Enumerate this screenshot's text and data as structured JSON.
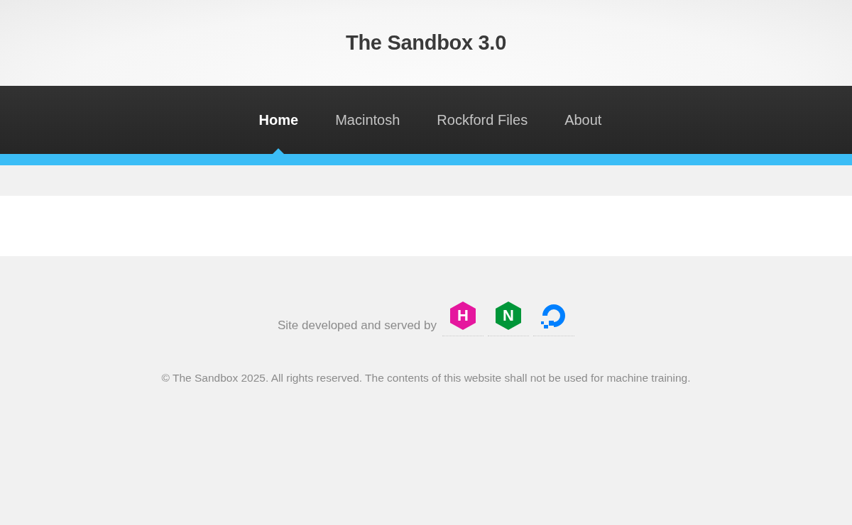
{
  "site_title": "The Sandbox 3.0",
  "nav": [
    {
      "label": "Home",
      "selected": true
    },
    {
      "label": "Macintosh",
      "selected": false
    },
    {
      "label": "Rockford Files",
      "selected": false
    },
    {
      "label": "About",
      "selected": false
    }
  ],
  "footer": {
    "credit": "Site developed and served by",
    "logos": [
      {
        "kind": "hexagon",
        "letter": "H",
        "color": "#e5179e"
      },
      {
        "kind": "hexagon",
        "letter": "N",
        "color": "#009639"
      },
      {
        "kind": "ring",
        "color": "#0080ff"
      }
    ],
    "copyright": "© The Sandbox 2025. All rights reserved. The contents of this website shall not be used for machine training."
  }
}
